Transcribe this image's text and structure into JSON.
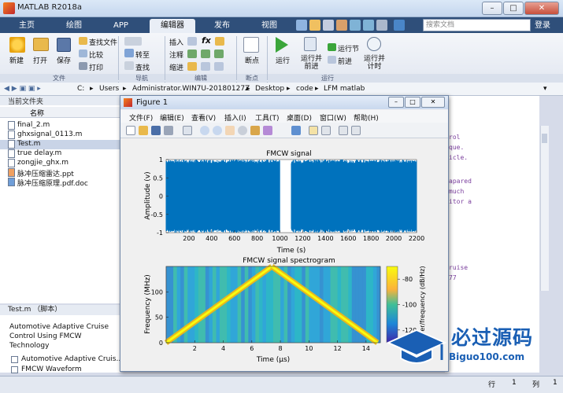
{
  "window": {
    "title": "MATLAB R2018a",
    "min": "–",
    "max": "□",
    "close": "✕"
  },
  "tabs": [
    "主页",
    "绘图",
    "APP",
    "编辑器",
    "发布",
    "视图"
  ],
  "search": {
    "placeholder": "搜索文档"
  },
  "login": "登录",
  "ribbon": {
    "new": "新建",
    "open": "打开",
    "save": "保存",
    "find_files": "查找文件",
    "compare": "比较",
    "print": "打印",
    "file_group": "文件",
    "goto": "转至",
    "find": "查找",
    "nav_group": "导航",
    "insert": "插入",
    "comment": "注释",
    "indent": "缩进",
    "edit_group": "编辑",
    "breakpoints": "断点",
    "bp_group": "断点",
    "run": "运行",
    "run_advance": "运行并\n前进",
    "run_section": "运行节",
    "advance": "前进",
    "run_time": "运行并\n计时",
    "run_group": "运行"
  },
  "address": [
    "C:",
    "Users",
    "Administrator.WIN7U-20180127Z",
    "Desktop",
    "code",
    "LFM matlab"
  ],
  "current_folder": {
    "title": "当前文件夹",
    "col_name": "名称",
    "files": [
      {
        "name": "final_2.m",
        "kind": "m"
      },
      {
        "name": "ghxsignal_0113.m",
        "kind": "m"
      },
      {
        "name": "Test.m",
        "kind": "m",
        "selected": true
      },
      {
        "name": "true delay.m",
        "kind": "m"
      },
      {
        "name": "zongjie_ghx.m",
        "kind": "m"
      },
      {
        "name": "脉冲压缩雷达.ppt",
        "kind": "ppt"
      },
      {
        "name": "脉冲压缩原理.pdf.doc",
        "kind": "doc"
      }
    ]
  },
  "details": {
    "title": "Test.m （脚本）",
    "desc": "Automotive Adaptive Cruise Control Using FMCW Technology",
    "item1": "Automotive Adaptive Cruis...",
    "item2": "FMCW Waveform"
  },
  "code_bg": [
    "rol",
    "que.",
    "icle.",
    "",
    "",
    "apared",
    "much",
    "itor a",
    "",
    "",
    "",
    "",
    "",
    "",
    "ruise",
    "77"
  ],
  "statusbar": {
    "row_label": "行",
    "row_val": "1",
    "col_label": "列",
    "col_val": "1"
  },
  "figure": {
    "title": "Figure 1",
    "menu": [
      "文件(F)",
      "编辑(E)",
      "查看(V)",
      "插入(I)",
      "工具(T)",
      "桌面(D)",
      "窗口(W)",
      "帮助(H)"
    ]
  },
  "watermark": {
    "text": "必过源码",
    "url": "Biguo100.com"
  },
  "chart_data": [
    {
      "type": "line",
      "title": "FMCW signal",
      "xlabel": "Time (s)",
      "ylabel": "Amplitude (v)",
      "xlim": [
        0,
        2200
      ],
      "ylim": [
        -1,
        1
      ],
      "xticks": [
        200,
        400,
        600,
        800,
        1000,
        1200,
        1400,
        1600,
        1800,
        2000,
        2200
      ],
      "yticks": [
        1,
        0.5,
        0,
        -0.5,
        -1
      ],
      "color": "#0072bd",
      "description_dense_segments": [
        [
          0,
          1000
        ],
        [
          1100,
          2200
        ]
      ]
    },
    {
      "type": "heatmap",
      "title": "FMCW signal spectrogram",
      "xlabel": "Time (μs)",
      "ylabel": "Frequency (MHz)",
      "colorbar_label": "Power/frequency (dB/Hz)",
      "xlim": [
        0,
        15
      ],
      "ylim": [
        0,
        150
      ],
      "xticks": [
        2,
        4,
        6,
        8,
        10,
        12,
        14
      ],
      "yticks": [
        100,
        50,
        0
      ],
      "cticks": [
        -80,
        -100,
        -120
      ],
      "chirp_up": {
        "x": [
          0,
          7.4
        ],
        "y": [
          0,
          150
        ]
      },
      "chirp_down": {
        "x": [
          7.4,
          14.8
        ],
        "y": [
          150,
          0
        ]
      }
    }
  ]
}
